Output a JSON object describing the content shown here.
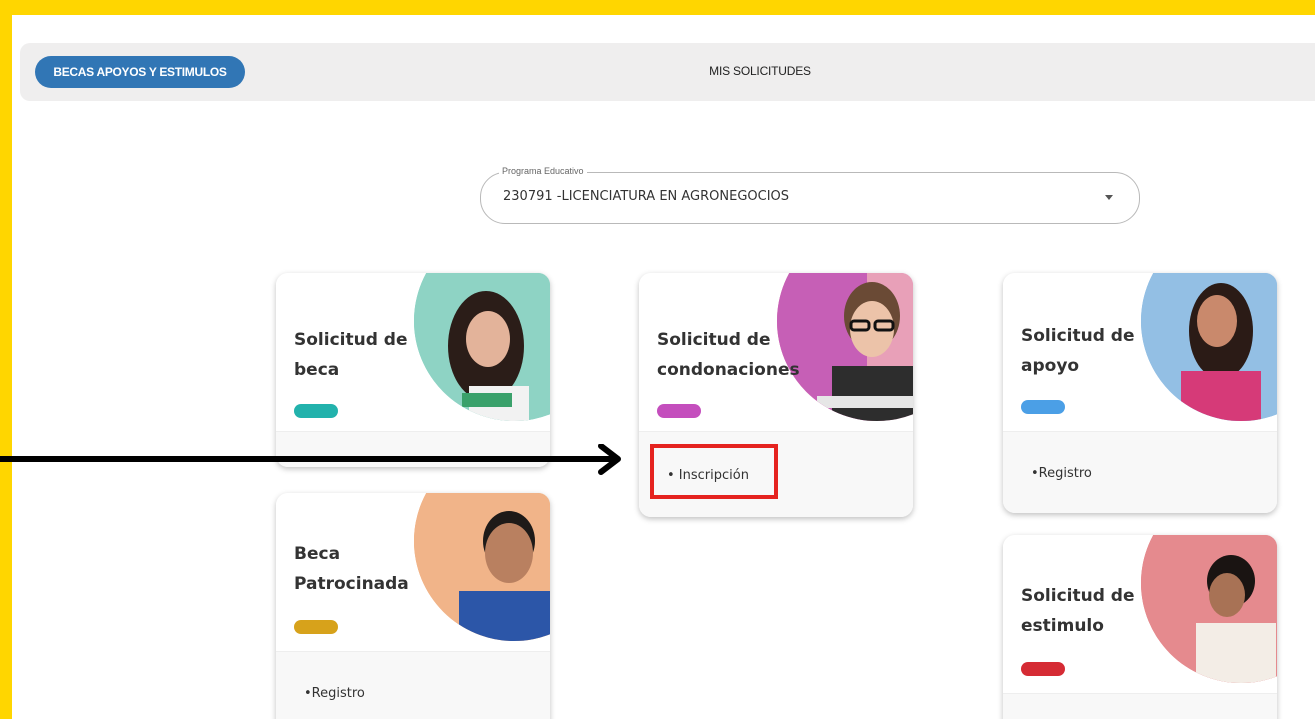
{
  "topbar": {
    "active_tab": "BECAS APOYOS Y ESTIMULOS",
    "tab_two": "MIS SOLICITUDES"
  },
  "program_select": {
    "legend": "Programa Educativo",
    "value": "230791 -LICENCIATURA EN AGRONEGOCIOS"
  },
  "cards": [
    {
      "title": "Solicitud de beca",
      "pill_color": "#22b2ac",
      "circle_color": "#7fcfc0",
      "link": ""
    },
    {
      "title": "Solicitud de condonaciones",
      "pill_color": "#c44ebd",
      "circle_color": "#d873b8",
      "link": "• Inscripción"
    },
    {
      "title": "Solicitud de apoyo",
      "pill_color": "#4b9fe6",
      "circle_color": "#89b8e1",
      "link": "•Registro"
    },
    {
      "title": "Beca Patrocinada",
      "pill_color": "#d7a21b",
      "circle_color": "#eea56a",
      "link": "•Registro"
    },
    {
      "title": "Solicitud de estimulo",
      "pill_color": "#d52b34",
      "circle_color": "#e07a7e",
      "link": ""
    }
  ],
  "colors": {
    "frame": "#FFD600",
    "tab_active": "#3176b5",
    "highlight": "#e5231f",
    "arrow": "#000000"
  }
}
